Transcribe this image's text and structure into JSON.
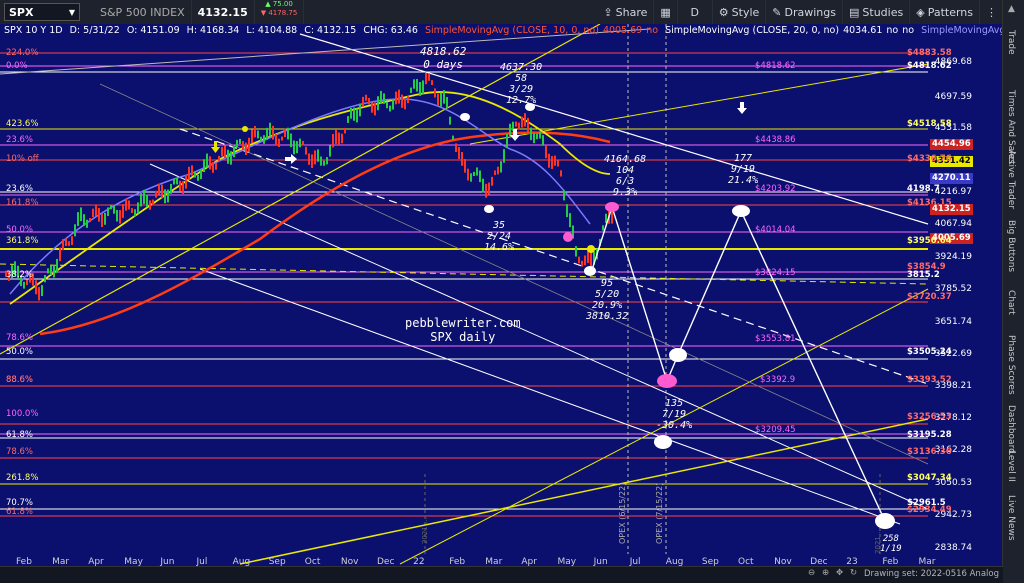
{
  "toolbar": {
    "symbol": "SPX",
    "interval": "10 Y 1D",
    "compare_title": "S&P 500 INDEX",
    "price": "4132.15",
    "change_up": "▲ 75.00",
    "change_down": "▼ 4178.75",
    "share": "Share",
    "d": "D",
    "style": "Style",
    "drawings": "Drawings",
    "studies": "Studies",
    "patterns": "Patterns"
  },
  "infoline": {
    "title": "SPX 10 Y 1D",
    "date": "D: 5/31/22",
    "open": "O: 4151.09",
    "high": "H: 4168.34",
    "low": "L: 4104.88",
    "close": "C: 4132.15",
    "change": "CHG: 63.46",
    "sma1": "SimpleMovingAvg (CLOSE, 10, 0, no)",
    "sma1_val": "4005.69",
    "no1": "no",
    "sma2": "SimpleMovingAvg (CLOSE, 20, 0, no)",
    "sma2_val": "4034.61",
    "no2": "no",
    "no3": "no",
    "sma3": "SimpleMovingAvg (CLOSE, 50,"
  },
  "price_axis": [
    {
      "label": "4869.68"
    },
    {
      "label": "4697.59"
    },
    {
      "label": "4531.58"
    },
    {
      "label": "4216.97"
    },
    {
      "label": "4067.94"
    },
    {
      "label": "3924.19"
    },
    {
      "label": "3785.52"
    },
    {
      "label": "3651.74"
    },
    {
      "label": "3522.69"
    },
    {
      "label": "3398.21"
    },
    {
      "label": "3278.12"
    },
    {
      "label": "3162.28"
    },
    {
      "label": "3050.53"
    },
    {
      "label": "2942.73"
    },
    {
      "label": "2838.74"
    }
  ],
  "axis_tags": {
    "t_4883": "$4883.58",
    "t_4818": "$4818.62",
    "t_4518": "$4518.58",
    "t_4454": "4454.96",
    "t_4351": "4351.42",
    "t_4336": "$4336.76",
    "t_4270": "4270.11",
    "t_4198": "4198.7",
    "t_4136": "$4136.15",
    "t_4132": "4132.15",
    "t_4005": "4005.69",
    "t_3956": "$3956.64",
    "t_3854": "$3854.9",
    "t_3815": "3815.2",
    "t_3720": "$3720.37",
    "t_3505": "$3505.24",
    "t_3393": "$3393.52",
    "t_3256": "$3256.53",
    "t_3195": "$3195.28",
    "t_3136": "$3136.36",
    "t_3047": "$3047.34",
    "t_2961": "$2961.5",
    "t_2934": "$2934.49"
  },
  "fib_left": [
    {
      "label": "224.0%",
      "color": "#ff6a6a"
    },
    {
      "label": "0.0%",
      "color": "#ff66ff"
    },
    {
      "label": "423.6%",
      "color": "#ffff66"
    },
    {
      "label": "23.6%",
      "color": "#ff66ff"
    },
    {
      "label": "10% off",
      "color": "#ff6a6a"
    },
    {
      "label": "23.6%",
      "color": "#ffffff"
    },
    {
      "label": "161.8%",
      "color": "#ff6a6a"
    },
    {
      "label": "50.0%",
      "color": "#ff66ff"
    },
    {
      "label": "361.8%",
      "color": "#ffff66"
    },
    {
      "label": "38.2%",
      "color": "#ffffff"
    },
    {
      "label": "78.6%",
      "color": "#ff66ff"
    },
    {
      "label": "50.0%",
      "color": "#ffffff"
    },
    {
      "label": "88.6%",
      "color": "#ff6a6a"
    },
    {
      "label": "88.6%",
      "color": "#ff6a6a"
    },
    {
      "label": "100.0%",
      "color": "#ff66ff"
    },
    {
      "label": "61.8%",
      "color": "#ffffff"
    },
    {
      "label": "78.6%",
      "color": "#ff6a6a"
    },
    {
      "label": "261.8%",
      "color": "#ffff66"
    },
    {
      "label": "70.7%",
      "color": "#ffffff"
    },
    {
      "label": "61.8%",
      "color": "#ff6a6a"
    }
  ],
  "fib_right": [
    {
      "label": "$4818.62",
      "color": "#ff66ff"
    },
    {
      "label": "$4438.86",
      "color": "#ff66ff"
    },
    {
      "label": "$4203.92",
      "color": "#ff66ff"
    },
    {
      "label": "$4014.04",
      "color": "#ff66ff"
    },
    {
      "label": "$3824.15",
      "color": "#ff66ff"
    },
    {
      "label": "$3553.81",
      "color": "#ff66ff"
    },
    {
      "label": "$3392.9",
      "color": "#ff66ff"
    },
    {
      "label": "$3209.45",
      "color": "#ff66ff"
    }
  ],
  "annotations": {
    "peak": "4818.62\n0 days",
    "a4637": "4637.30\n58\n3/29\n12.7%",
    "a4164": "4164.68\n104\n6/3\n9.3%",
    "a35": "35\n2/24\n14.6%",
    "a95": "95\n5/20\n20.9%\n3810.32",
    "a177": "177\n9/19\n21.4%",
    "a135": "135\n7/19\n-30.4%",
    "a258": "258\n1/19",
    "site": "pebblewriter.com\nSPX daily"
  },
  "vertical_labels": {
    "opex1": "OPEX (6/15/22)",
    "opex2": "OPEX (7/15/22)",
    "y2021a": "2021 ...",
    "y2021b": "2021 ..."
  },
  "time_axis": [
    "Feb",
    "Mar",
    "Apr",
    "May",
    "Jun",
    "Jul",
    "Aug",
    "Sep",
    "Oct",
    "Nov",
    "Dec",
    "22",
    "Feb",
    "Mar",
    "Apr",
    "May",
    "Jun",
    "Jul",
    "Aug",
    "Sep",
    "Oct",
    "Nov",
    "Dec",
    "23",
    "Feb",
    "Mar"
  ],
  "right_tabs": [
    "Trade",
    "Times And Sales",
    "Active Trader",
    "Big Buttons",
    "Chart",
    "Phase Scores",
    "Dashboard",
    "Level II",
    "Live News"
  ],
  "bottom": {
    "drawing_set": "Drawing set: 2022-0516 Analog"
  },
  "colors": {
    "bg": "#0b0f6e",
    "price_tag": "#cc2222",
    "sma_red": "#ff4422",
    "yellow": "#e8e800",
    "white_line": "#ffffff",
    "magenta": "#ff66ff"
  }
}
